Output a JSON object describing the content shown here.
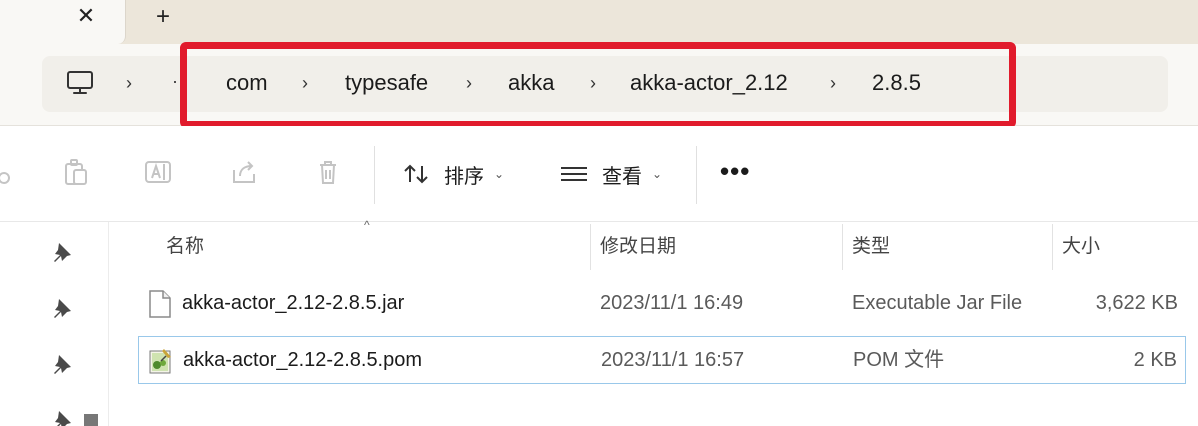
{
  "tabs": {
    "close_glyph": "✕",
    "new_tab_glyph": "+"
  },
  "breadcrumb": {
    "separator": "›",
    "overflow": "··",
    "items": [
      "com",
      "typesafe",
      "akka",
      "akka-actor_2.12",
      "2.8.5"
    ]
  },
  "toolbar": {
    "sort_label": "排序",
    "view_label": "查看",
    "more_label": "•••",
    "chevron": "⌄"
  },
  "columns": {
    "sort_indicator": "^",
    "name": "名称",
    "date": "修改日期",
    "type": "类型",
    "size": "大小"
  },
  "files": [
    {
      "name": "akka-actor_2.12-2.8.5.jar",
      "date": "2023/11/1 16:49",
      "type": "Executable Jar File",
      "size": "3,622 KB",
      "icon": "blank-file-icon"
    },
    {
      "name": "akka-actor_2.12-2.8.5.pom",
      "date": "2023/11/1 16:57",
      "type": "POM 文件",
      "size": "2 KB",
      "icon": "pom-file-icon"
    }
  ],
  "colors": {
    "highlight_border": "#e11b2c",
    "selection_border": "#99c8ea",
    "titlebar_bg": "#ece6da"
  }
}
